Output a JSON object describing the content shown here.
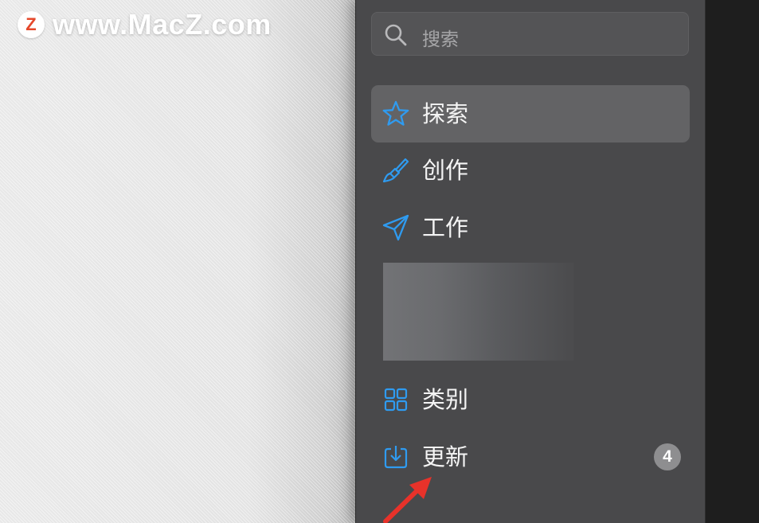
{
  "watermark": {
    "logo_letter": "Z",
    "text": "www.MacZ.com"
  },
  "sidebar": {
    "search": {
      "placeholder": "搜索",
      "icon": "search-icon"
    },
    "items": [
      {
        "label": "探索",
        "icon": "star-icon",
        "active": true
      },
      {
        "label": "创作",
        "icon": "brush-icon",
        "active": false
      },
      {
        "label": "工作",
        "icon": "paper-plane-icon",
        "active": false
      },
      {
        "label": "类别",
        "icon": "grid-icon",
        "active": false
      },
      {
        "label": "更新",
        "icon": "download-tray-icon",
        "active": false,
        "badge": "4"
      }
    ]
  },
  "colors": {
    "sidebar_bg": "#49494b",
    "active_item_bg": "#636365",
    "icon_accent": "#2f9bf0",
    "annotation_arrow": "#e8322a"
  }
}
